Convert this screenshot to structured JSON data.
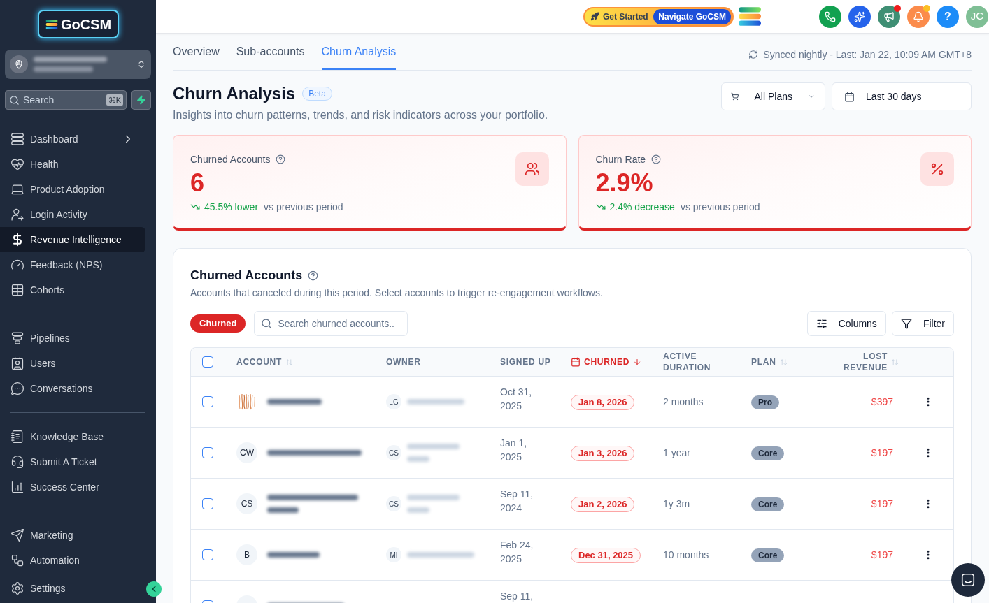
{
  "sidebar": {
    "logo": {
      "text": "GoCSM"
    },
    "search": {
      "placeholder": "Search",
      "shortcut": "⌘K"
    },
    "nav_groups": [
      [
        {
          "label": "Dashboard",
          "kind": "group",
          "selected": false
        },
        {
          "label": "Health",
          "kind": "link",
          "selected": false
        },
        {
          "label": "Product Adoption",
          "kind": "link",
          "selected": false
        },
        {
          "label": "Login Activity",
          "kind": "link",
          "selected": false
        },
        {
          "label": "Revenue Intelligence",
          "kind": "link",
          "selected": true
        },
        {
          "label": "Feedback (NPS)",
          "kind": "link",
          "selected": false
        },
        {
          "label": "Cohorts",
          "kind": "link",
          "selected": false
        }
      ],
      [
        {
          "label": "Pipelines",
          "kind": "link",
          "selected": false
        },
        {
          "label": "Users",
          "kind": "link",
          "selected": false
        },
        {
          "label": "Conversations",
          "kind": "link",
          "selected": false
        }
      ],
      [
        {
          "label": "Knowledge Base",
          "kind": "link",
          "selected": false
        },
        {
          "label": "Submit A Ticket",
          "kind": "link",
          "selected": false
        },
        {
          "label": "Success Center",
          "kind": "link",
          "selected": false
        }
      ],
      [
        {
          "label": "Marketing",
          "kind": "link",
          "selected": false
        },
        {
          "label": "Automation",
          "kind": "link",
          "selected": false
        }
      ]
    ],
    "settings": {
      "label": "Settings",
      "selected": false
    }
  },
  "topbar": {
    "get_started": {
      "label": "Get Started",
      "action": "Navigate GoCSM"
    },
    "actions": [
      {
        "has_dot": false
      },
      {
        "has_dot": false
      },
      {
        "has_dot": true,
        "color": "#ef1c1c"
      },
      {
        "has_dot": true,
        "color": "#fbbf24"
      },
      {
        "has_dot": false,
        "label": "?"
      }
    ],
    "user": {
      "initials": "JC"
    }
  },
  "tabs": [
    {
      "label": "Overview",
      "selected": false
    },
    {
      "label": "Sub-accounts",
      "selected": false
    },
    {
      "label": "Churn Analysis",
      "selected": true
    }
  ],
  "sync_status": "Synced nightly - Last: Jan 22, 10:09 AM GMT+8",
  "header": {
    "title": "Churn Analysis",
    "badge": "Beta",
    "subtitle": "Insights into churn patterns, trends, and risk indicators across your portfolio.",
    "filters": [
      {
        "kind": "plan",
        "label": "All Plans"
      },
      {
        "kind": "date",
        "label": "Last 30 days"
      }
    ]
  },
  "metrics": [
    {
      "label": "Churned Accounts",
      "value": "6",
      "change": "45.5% lower",
      "comparison": "vs previous period"
    },
    {
      "label": "Churn Rate",
      "value": "2.9%",
      "change": "2.4% decrease",
      "comparison": "vs previous period"
    }
  ],
  "churned_table": {
    "title": "Churned Accounts",
    "description": "Accounts that canceled during this period. Select accounts to trigger re-engagement workflows.",
    "status_chip": "Churned",
    "search": {
      "placeholder": "Search churned accounts.."
    },
    "buttons": [
      {
        "kind": "columns",
        "label": "Columns"
      },
      {
        "kind": "filter",
        "label": "Filter"
      }
    ],
    "select_all": {
      "checked": false
    },
    "columns": [
      {
        "label": "ACCOUNT",
        "sortable": true,
        "sorted": false
      },
      {
        "label": "OWNER",
        "sortable": false,
        "sorted": false
      },
      {
        "label": "SIGNED UP",
        "sortable": false,
        "sorted": false
      },
      {
        "label": "CHURNED",
        "sortable": true,
        "sorted": true
      },
      {
        "label": "ACTIVE DURATION",
        "sortable": false,
        "sorted": false
      },
      {
        "label": "PLAN",
        "sortable": true,
        "sorted": false
      },
      {
        "label": "LOST REVENUE",
        "sortable": true,
        "sorted": false
      }
    ],
    "rows": [
      {
        "checked": false,
        "account_avatar": {
          "kind": "logo"
        },
        "owner_initials": "LG",
        "signed_up": "Oct 31, 2025",
        "churned": "Jan 8, 2026",
        "active_duration": "2 months",
        "plan": "Pro",
        "lost_revenue": "$397"
      },
      {
        "checked": false,
        "account_avatar": {
          "kind": "initials",
          "text": "CW"
        },
        "owner_initials": "CS",
        "signed_up": "Jan 1, 2025",
        "churned": "Jan 3, 2026",
        "active_duration": "1 year",
        "plan": "Core",
        "lost_revenue": "$197"
      },
      {
        "checked": false,
        "account_avatar": {
          "kind": "initials",
          "text": "CS"
        },
        "owner_initials": "CS",
        "signed_up": "Sep 11, 2024",
        "churned": "Jan 2, 2026",
        "active_duration": "1y 3m",
        "plan": "Core",
        "lost_revenue": "$197"
      },
      {
        "checked": false,
        "account_avatar": {
          "kind": "initials",
          "text": "B"
        },
        "owner_initials": "MI",
        "signed_up": "Feb 24, 2025",
        "churned": "Dec 31, 2025",
        "active_duration": "10 months",
        "plan": "Core",
        "lost_revenue": "$197"
      },
      {
        "checked": false,
        "account_avatar": {
          "kind": "initials"
        },
        "signed_up": "Sep 11,"
      }
    ]
  }
}
